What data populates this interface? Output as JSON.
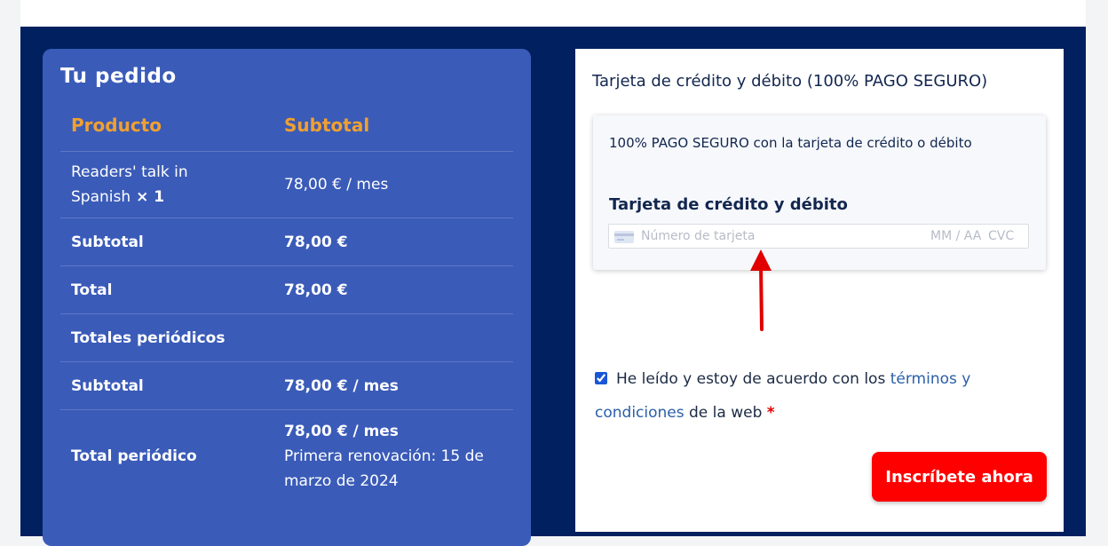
{
  "order": {
    "title": "Tu pedido",
    "header_product": "Producto",
    "header_subtotal": "Subtotal",
    "item_name": "Readers' talk in Spanish",
    "item_qty": "× 1",
    "item_price": "78,00 € / mes",
    "subtotal_label": "Subtotal",
    "subtotal_value": "78,00 €",
    "total_label": "Total",
    "total_value": "78,00 €",
    "recurring_label": "Totales periódicos",
    "recurring_subtotal_label": "Subtotal",
    "recurring_subtotal_value": "78,00 € / mes",
    "recurring_total_label": "Total periódico",
    "recurring_total_value": "78,00 € / mes",
    "renewal_text": "Primera renovación: 15 de marzo de 2024"
  },
  "payment": {
    "title": "Tarjeta de crédito y débito (100% PAGO SEGURO)",
    "secure_note": "100% PAGO SEGURO con la tarjeta de crédito o débito",
    "card_label": "Tarjeta de crédito y débito",
    "card_number_placeholder": "Número de tarjeta",
    "expiry_placeholder": "MM / AA",
    "cvc_placeholder": "CVC"
  },
  "terms": {
    "checked": true,
    "text_before": "He leído y estoy de acuerdo con los ",
    "link_text": "términos y condiciones",
    "text_after": " de la web ",
    "required_mark": "*"
  },
  "submit_label": "Inscríbete ahora",
  "colors": {
    "page_background": "#002060",
    "order_card": "#3a5bb8",
    "header_accent": "#f0a030",
    "submit_button": "#ff0000",
    "annotation_arrow": "#e00000"
  }
}
